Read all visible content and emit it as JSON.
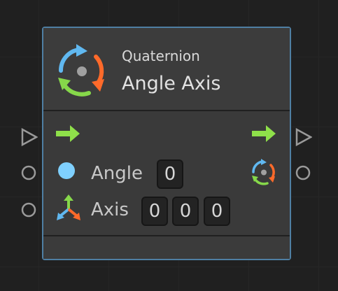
{
  "node": {
    "subtitle": "Quaternion",
    "title": "Angle Axis",
    "icon": "quaternion-rotation-icon"
  },
  "inputs": {
    "angle": {
      "label": "Angle",
      "value": "0",
      "icon": "circle-dot-icon"
    },
    "axis": {
      "label": "Axis",
      "values": [
        "0",
        "0",
        "0"
      ],
      "icon": "axes-arrows-icon"
    }
  },
  "ports": {
    "flow_in_icon": "flow-arrow-icon",
    "flow_out_icon": "flow-arrow-icon",
    "output_icon": "quaternion-rotation-icon"
  },
  "colors": {
    "border": "#4f7fa3",
    "flow_arrow": "#8fe04a",
    "angle_dot": "#7fd0ff",
    "icon_blue": "#60b8f0",
    "icon_orange": "#ff6a2a",
    "icon_green": "#86d84a"
  }
}
